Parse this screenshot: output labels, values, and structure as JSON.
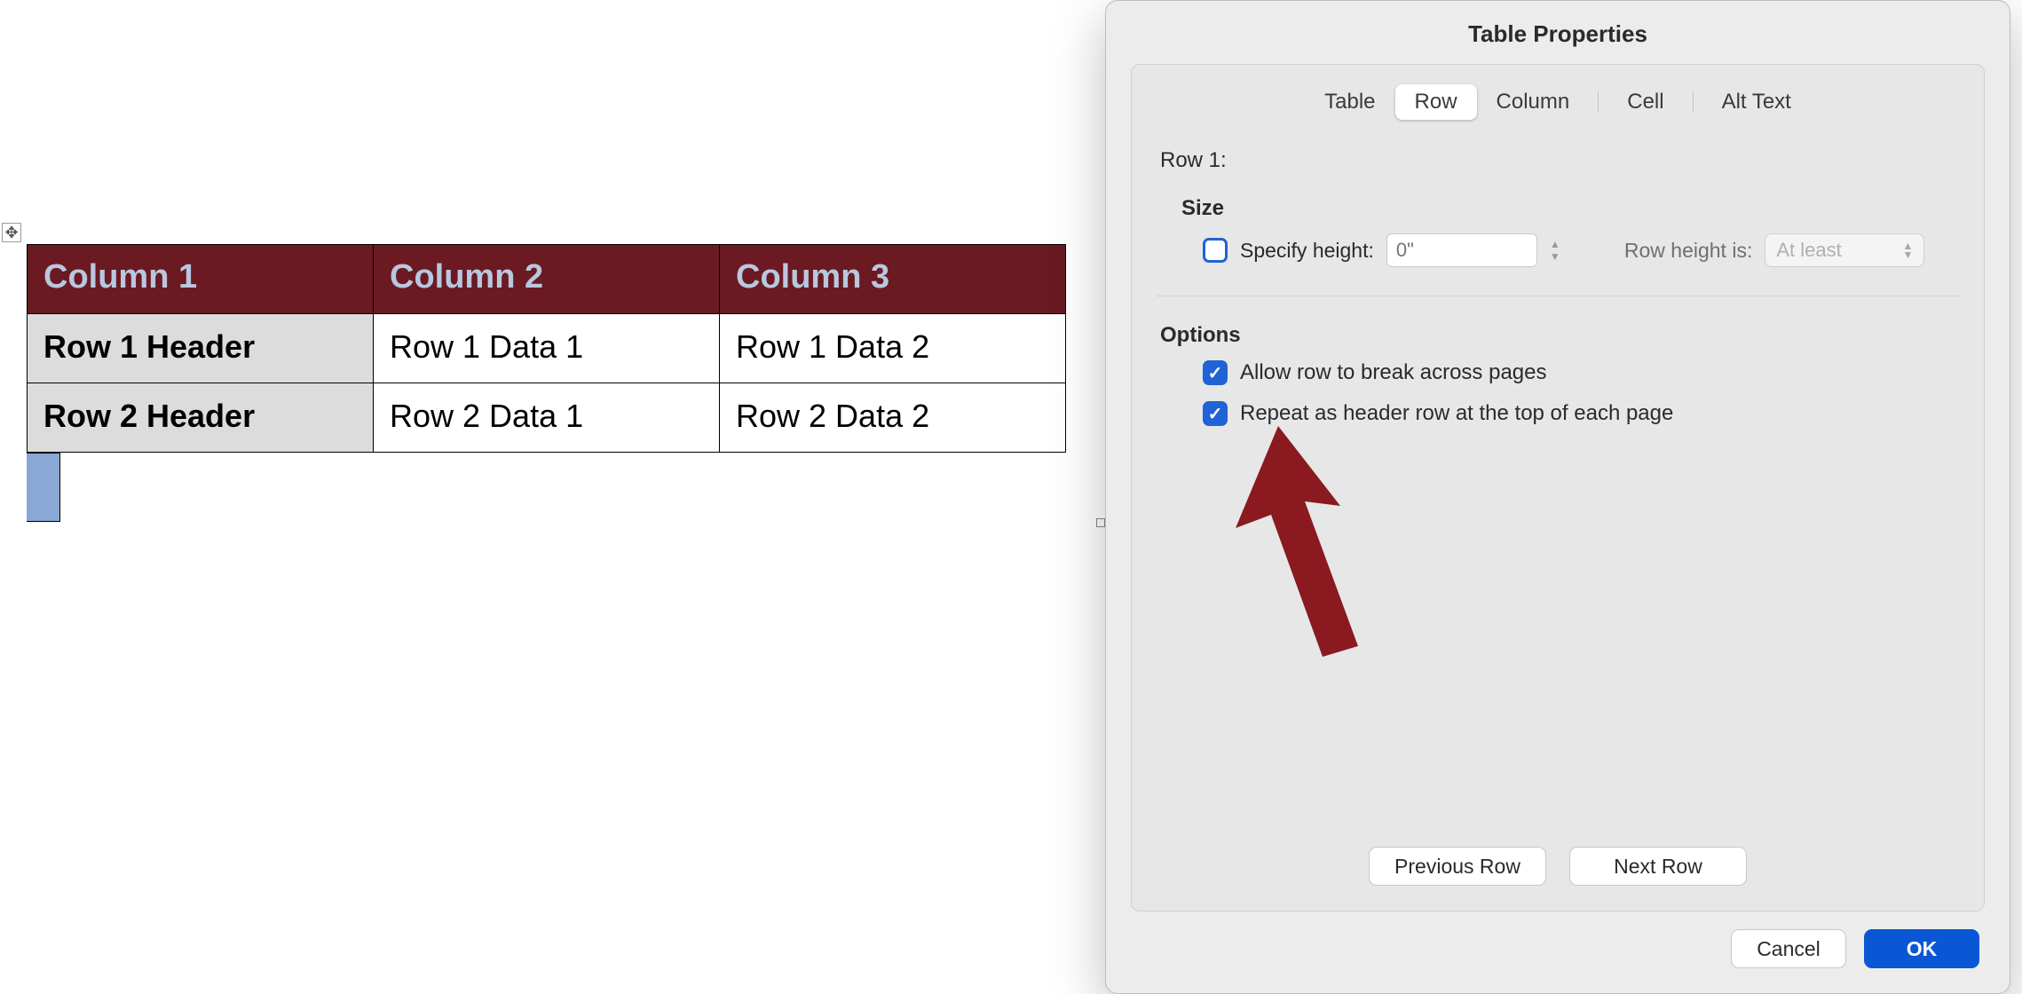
{
  "dialog": {
    "title": "Table Properties",
    "tabs": {
      "table": "Table",
      "row": "Row",
      "column": "Column",
      "cell": "Cell",
      "alt": "Alt Text"
    },
    "row_label": "Row 1:",
    "size_section": "Size",
    "specify_height_label": "Specify height:",
    "height_value_placeholder": "0\"",
    "row_height_is_label": "Row height is:",
    "row_height_select_value": "At least",
    "options_section": "Options",
    "allow_break_label": "Allow row to break across pages",
    "repeat_header_label": "Repeat as header row at the top of each page",
    "prev_row": "Previous Row",
    "next_row": "Next Row",
    "cancel": "Cancel",
    "ok": "OK"
  },
  "table": {
    "headers": [
      "Column 1",
      "Column 2",
      "Column 3"
    ],
    "rows": [
      {
        "hdr": "Row 1 Header",
        "c1": "Row 1 Data 1",
        "c2": "Row 1 Data 2"
      },
      {
        "hdr": "Row 2 Header",
        "c1": "Row 2 Data 1",
        "c2": "Row 2 Data 2"
      }
    ]
  }
}
